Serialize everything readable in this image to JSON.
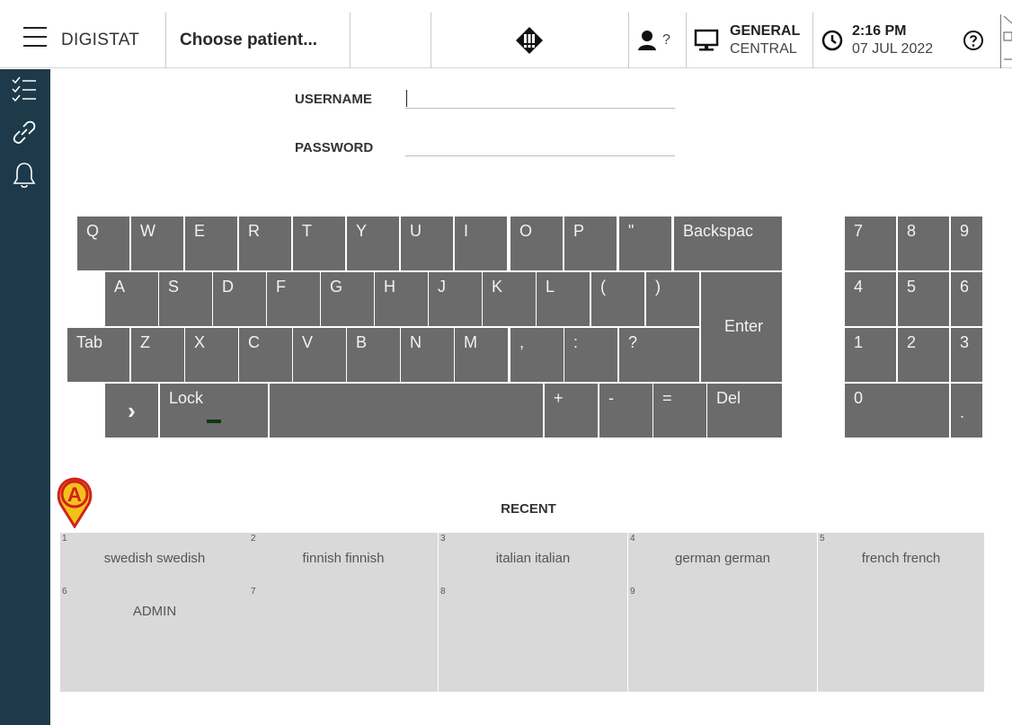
{
  "topbar": {
    "brand": "DIGISTAT",
    "patient": "Choose patient...",
    "user_status": "?",
    "workstation_line1": "GENERAL",
    "workstation_line2": "CENTRAL",
    "time": "2:16 PM",
    "date": "07 JUL 2022"
  },
  "sidebar": {
    "icons": [
      "checklist-icon",
      "link-icon",
      "bell-icon"
    ]
  },
  "login": {
    "username_label": "USERNAME",
    "username_value": "",
    "password_label": "PASSWORD",
    "password_value": ""
  },
  "keyboard": {
    "row1": [
      "Q",
      "W",
      "E",
      "R",
      "T",
      "Y",
      "U",
      "I",
      "O",
      "P",
      "\"",
      "Backspac"
    ],
    "row2": [
      "A",
      "S",
      "D",
      "F",
      "G",
      "H",
      "J",
      "K",
      "L",
      "(",
      ")"
    ],
    "enter": "Enter",
    "row3": [
      "Tab",
      "Z",
      "X",
      "C",
      "V",
      "B",
      "N",
      "M",
      ",",
      ":",
      "?"
    ],
    "row4_arrow": "›",
    "lock": "Lock",
    "row4_right": [
      "+",
      "-",
      "=",
      "Del"
    ],
    "numpad": [
      "7",
      "8",
      "9",
      "4",
      "5",
      "6",
      "1",
      "2",
      "3",
      "0",
      "."
    ]
  },
  "recent": {
    "title": "RECENT",
    "cells": [
      {
        "num": "1",
        "name": "swedish swedish"
      },
      {
        "num": "2",
        "name": "finnish finnish"
      },
      {
        "num": "3",
        "name": "italian italian"
      },
      {
        "num": "4",
        "name": "german german"
      },
      {
        "num": "5",
        "name": "french french"
      },
      {
        "num": "6",
        "name": "ADMIN"
      },
      {
        "num": "7",
        "name": ""
      },
      {
        "num": "8",
        "name": ""
      },
      {
        "num": "9",
        "name": ""
      },
      {
        "num": "",
        "name": ""
      },
      {
        "num": "",
        "name": ""
      },
      {
        "num": "",
        "name": ""
      },
      {
        "num": "",
        "name": ""
      },
      {
        "num": "",
        "name": ""
      },
      {
        "num": "",
        "name": ""
      }
    ]
  },
  "annotation": {
    "marker_letter": "A",
    "marker_color": "#f3c21a",
    "marker_border": "#d0211c"
  },
  "colors": {
    "sidebar": "#1e3a4a",
    "key": "#6b6b6b",
    "recent_cell": "#d9d9d9"
  }
}
